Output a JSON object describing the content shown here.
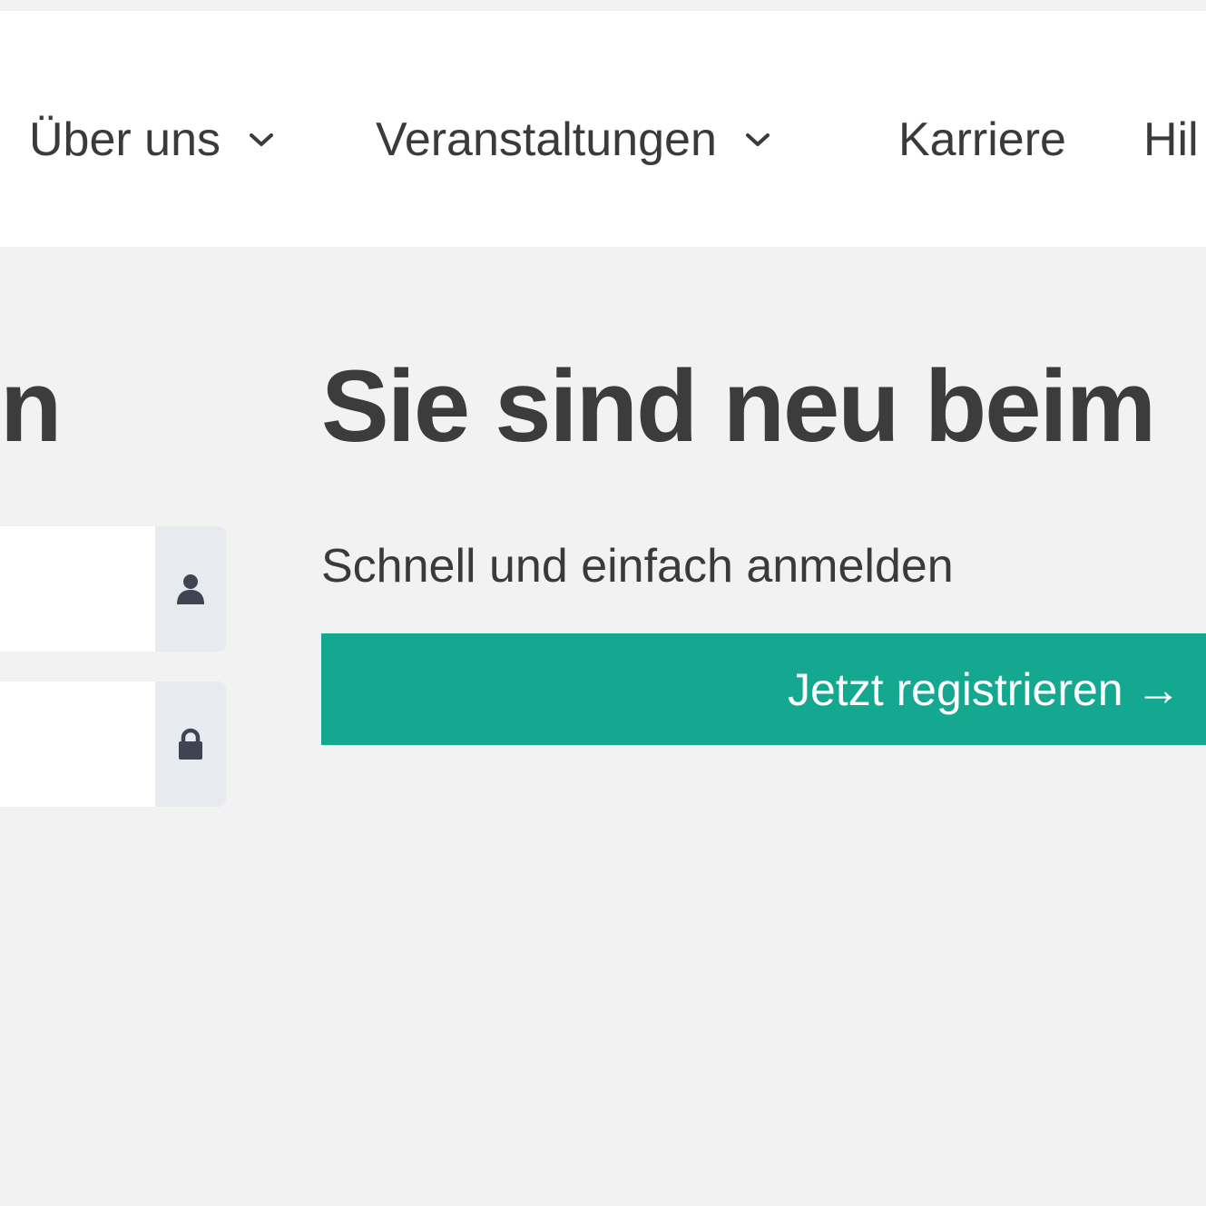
{
  "nav": {
    "items": [
      {
        "label": "Über uns",
        "has_dropdown": true
      },
      {
        "label": "Veranstaltungen",
        "has_dropdown": true
      },
      {
        "label": "Karriere",
        "has_dropdown": false
      },
      {
        "label": "Hil",
        "has_dropdown": false
      }
    ]
  },
  "login": {
    "heading": "n",
    "username_icon": "user-icon",
    "password_icon": "lock-icon"
  },
  "register": {
    "heading": "Sie sind neu beim",
    "subtext": "Schnell und einfach anmelden",
    "button_label": "Jetzt registrieren →"
  },
  "colors": {
    "accent": "#14a890",
    "background": "#f2f2f2",
    "header_bg": "#ffffff",
    "text": "#3c3c3c",
    "addon_bg": "#e7eaee"
  }
}
